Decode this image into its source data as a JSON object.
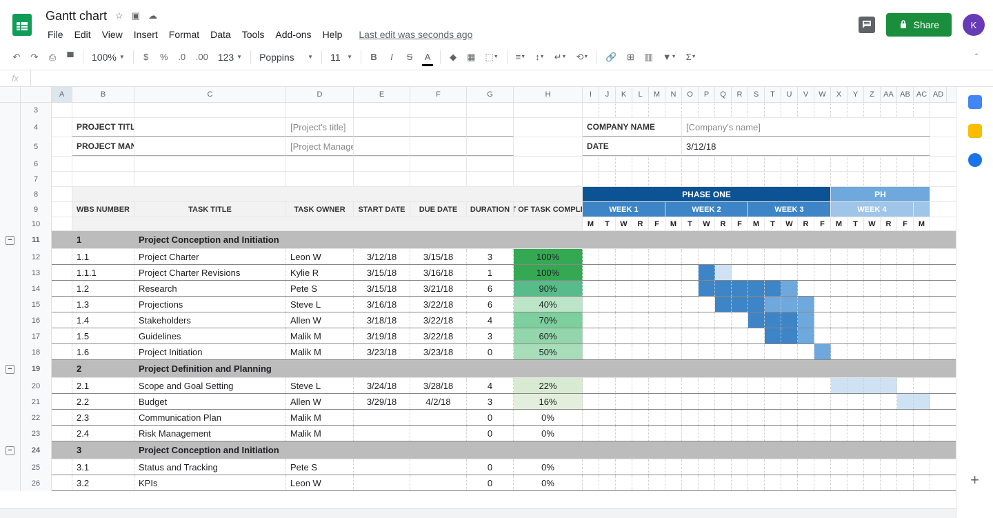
{
  "doc_title": "Gantt chart",
  "last_edit": "Last edit was seconds ago",
  "menus": [
    "File",
    "Edit",
    "View",
    "Insert",
    "Format",
    "Data",
    "Tools",
    "Add-ons",
    "Help"
  ],
  "share_label": "Share",
  "avatar_letter": "K",
  "zoom": "100%",
  "font_family": "Poppins",
  "font_size": "11",
  "fx_label": "fx",
  "columns": [
    "A",
    "B",
    "C",
    "D",
    "E",
    "F",
    "G",
    "H",
    "I",
    "J",
    "K",
    "L",
    "M",
    "N",
    "O",
    "P",
    "Q",
    "R",
    "S",
    "T",
    "U",
    "V",
    "W",
    "X",
    "Y",
    "Z",
    "AA",
    "AB",
    "AC",
    "AD"
  ],
  "row_nums": [
    3,
    4,
    5,
    6,
    7,
    8,
    9,
    10,
    11,
    12,
    13,
    14,
    15,
    16,
    17,
    18,
    19,
    20,
    21,
    22,
    23,
    24,
    25,
    26
  ],
  "info": {
    "project_title_label": "PROJECT TITLE",
    "project_title_value": "[Project's title]",
    "project_manager_label": "PROJECT MANAGER",
    "project_manager_value": "[Project Manager's name]",
    "company_name_label": "COMPANY NAME",
    "company_name_value": "[Company's name]",
    "date_label": "DATE",
    "date_value": "3/12/18"
  },
  "table_headers": {
    "wbs": "WBS NUMBER",
    "task_title": "TASK TITLE",
    "task_owner": "TASK OWNER",
    "start": "START DATE",
    "due": "DUE DATE",
    "duration": "DURATION",
    "pct": "PCT OF TASK COMPLETE",
    "phase1": "PHASE ONE",
    "phase_partial": "PH",
    "weeks": [
      "WEEK 1",
      "WEEK 2",
      "WEEK 3",
      "WEEK 4"
    ],
    "days": [
      "M",
      "T",
      "W",
      "R",
      "F"
    ]
  },
  "sections": [
    {
      "num": "1",
      "title": "Project Conception and Initiation",
      "rows": [
        {
          "wbs": "1.1",
          "title": "Project Charter",
          "owner": "Leon W",
          "start": "3/12/18",
          "due": "3/15/18",
          "dur": "3",
          "pct": "100%",
          "pctClass": "pct-100",
          "bars": [
            [
              "x",
              "x",
              "x",
              "x",
              "",
              "",
              "",
              "",
              "",
              "",
              "",
              "",
              "",
              "",
              "",
              "",
              "",
              "",
              "",
              "",
              ""
            ],
            [
              "gantt-fill-dark",
              "gantt-fill-dark",
              "gantt-fill-dark",
              "gantt-fill-mid"
            ],
            [
              0,
              0,
              0,
              0,
              3,
              3,
              3,
              2,
              0,
              0,
              0,
              0,
              0,
              0,
              0,
              0,
              0,
              0,
              0,
              0,
              0
            ]
          ]
        },
        {
          "wbs": "1.1.1",
          "title": "Project Charter Revisions",
          "owner": "Kylie R",
          "start": "3/15/18",
          "due": "3/16/18",
          "dur": "1",
          "pct": "100%",
          "pctClass": "pct-100",
          "bars": [
            [
              0,
              0,
              0,
              0,
              0,
              0,
              0,
              3,
              1,
              0,
              0,
              0,
              0,
              0,
              0,
              0,
              0,
              0,
              0,
              0,
              0
            ]
          ]
        },
        {
          "wbs": "1.2",
          "title": "Research",
          "owner": "Pete S",
          "start": "3/15/18",
          "due": "3/21/18",
          "dur": "6",
          "pct": "90%",
          "pctClass": "pct-90",
          "bars": [
            [
              0,
              0,
              0,
              0,
              0,
              0,
              0,
              3,
              3,
              3,
              3,
              3,
              2,
              0,
              0,
              0,
              0,
              0,
              0,
              0,
              0
            ]
          ]
        },
        {
          "wbs": "1.3",
          "title": "Projections",
          "owner": "Steve L",
          "start": "3/16/18",
          "due": "3/22/18",
          "dur": "6",
          "pct": "40%",
          "pctClass": "pct-40",
          "bars": [
            [
              0,
              0,
              0,
              0,
              0,
              0,
              0,
              0,
              3,
              3,
              3,
              2,
              2,
              2,
              0,
              0,
              0,
              0,
              0,
              0,
              0
            ]
          ]
        },
        {
          "wbs": "1.4",
          "title": "Stakeholders",
          "owner": "Allen W",
          "start": "3/18/18",
          "due": "3/22/18",
          "dur": "4",
          "pct": "70%",
          "pctClass": "pct-70",
          "bars": [
            [
              0,
              0,
              0,
              0,
              0,
              0,
              0,
              0,
              0,
              0,
              3,
              3,
              3,
              2,
              0,
              0,
              0,
              0,
              0,
              0,
              0
            ]
          ]
        },
        {
          "wbs": "1.5",
          "title": "Guidelines",
          "owner": "Malik M",
          "start": "3/19/18",
          "due": "3/22/18",
          "dur": "3",
          "pct": "60%",
          "pctClass": "pct-60",
          "bars": [
            [
              0,
              0,
              0,
              0,
              0,
              0,
              0,
              0,
              0,
              0,
              0,
              3,
              3,
              2,
              0,
              0,
              0,
              0,
              0,
              0,
              0
            ]
          ]
        },
        {
          "wbs": "1.6",
          "title": "Project Initiation",
          "owner": "Malik M",
          "start": "3/23/18",
          "due": "3/23/18",
          "dur": "0",
          "pct": "50%",
          "pctClass": "pct-50",
          "bars": [
            [
              0,
              0,
              0,
              0,
              0,
              0,
              0,
              0,
              0,
              0,
              0,
              0,
              0,
              0,
              2,
              0,
              0,
              0,
              0,
              0,
              0
            ]
          ]
        }
      ]
    },
    {
      "num": "2",
      "title": "Project Definition and Planning",
      "rows": [
        {
          "wbs": "2.1",
          "title": "Scope and Goal Setting",
          "owner": "Steve L",
          "start": "3/24/18",
          "due": "3/28/18",
          "dur": "4",
          "pct": "22%",
          "pctClass": "pct-22",
          "bars": [
            [
              0,
              0,
              0,
              0,
              0,
              0,
              0,
              0,
              0,
              0,
              0,
              0,
              0,
              0,
              0,
              1,
              1,
              1,
              1,
              0,
              0
            ]
          ]
        },
        {
          "wbs": "2.2",
          "title": "Budget",
          "owner": "Allen W",
          "start": "3/29/18",
          "due": "4/2/18",
          "dur": "3",
          "pct": "16%",
          "pctClass": "pct-16",
          "bars": [
            [
              0,
              0,
              0,
              0,
              0,
              0,
              0,
              0,
              0,
              0,
              0,
              0,
              0,
              0,
              0,
              0,
              0,
              0,
              0,
              1,
              1
            ]
          ]
        },
        {
          "wbs": "2.3",
          "title": "Communication Plan",
          "owner": "Malik M",
          "start": "",
          "due": "",
          "dur": "0",
          "pct": "0%",
          "pctClass": "pct-0",
          "bars": [
            [
              0,
              0,
              0,
              0,
              0,
              0,
              0,
              0,
              0,
              0,
              0,
              0,
              0,
              0,
              0,
              0,
              0,
              0,
              0,
              0,
              0
            ]
          ]
        },
        {
          "wbs": "2.4",
          "title": "Risk Management",
          "owner": "Malik M",
          "start": "",
          "due": "",
          "dur": "0",
          "pct": "0%",
          "pctClass": "pct-0",
          "bars": [
            [
              0,
              0,
              0,
              0,
              0,
              0,
              0,
              0,
              0,
              0,
              0,
              0,
              0,
              0,
              0,
              0,
              0,
              0,
              0,
              0,
              0
            ]
          ]
        }
      ]
    },
    {
      "num": "3",
      "title": "Project Conception and Initiation",
      "rows": [
        {
          "wbs": "3.1",
          "title": "Status and Tracking",
          "owner": "Pete S",
          "start": "",
          "due": "",
          "dur": "0",
          "pct": "0%",
          "pctClass": "pct-0",
          "bars": [
            [
              0,
              0,
              0,
              0,
              0,
              0,
              0,
              0,
              0,
              0,
              0,
              0,
              0,
              0,
              0,
              0,
              0,
              0,
              0,
              0,
              0
            ]
          ]
        },
        {
          "wbs": "3.2",
          "title": "KPIs",
          "owner": "Leon W",
          "start": "",
          "due": "",
          "dur": "0",
          "pct": "0%",
          "pctClass": "pct-0",
          "bars": [
            [
              0,
              0,
              0,
              0,
              0,
              0,
              0,
              0,
              0,
              0,
              0,
              0,
              0,
              0,
              0,
              0,
              0,
              0,
              0,
              0,
              0
            ]
          ]
        }
      ]
    }
  ]
}
